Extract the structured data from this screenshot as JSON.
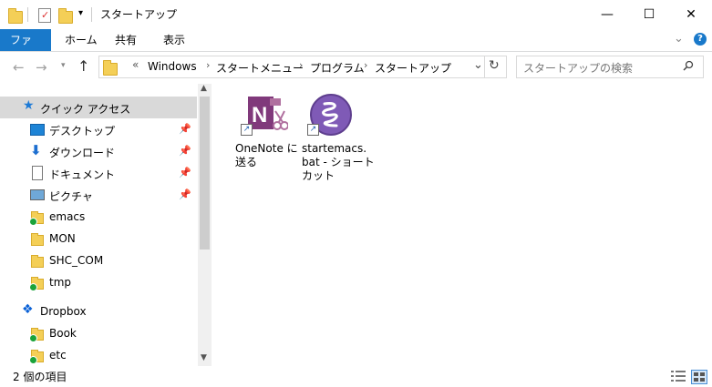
{
  "window": {
    "title": "スタートアップ",
    "controls": {
      "minimize": "—",
      "maximize": "☐",
      "close": "✕"
    }
  },
  "ribbon": {
    "tabs": [
      {
        "label": "ファイル",
        "active": true
      },
      {
        "label": "ホーム"
      },
      {
        "label": "共有"
      },
      {
        "label": "表示"
      }
    ],
    "expand": "⌄",
    "help": "?"
  },
  "address": {
    "overflow": "«",
    "crumbs": [
      "Windows",
      "スタートメニュー",
      "プログラム",
      "スタートアップ"
    ],
    "dropdown": "⌄",
    "refresh": "↻"
  },
  "search": {
    "placeholder": "スタートアップの検索",
    "icon": "search-icon"
  },
  "sidebar": {
    "quick_access": "クイック アクセス",
    "items": [
      {
        "label": "デスクトップ",
        "icon": "desktop-icon",
        "pinned": true
      },
      {
        "label": "ダウンロード",
        "icon": "download-icon",
        "pinned": true
      },
      {
        "label": "ドキュメント",
        "icon": "document-icon",
        "pinned": true
      },
      {
        "label": "ピクチャ",
        "icon": "picture-icon",
        "pinned": true
      },
      {
        "label": "emacs",
        "icon": "folder-icon",
        "synced": true
      },
      {
        "label": "MON",
        "icon": "folder-icon"
      },
      {
        "label": "SHC_COM",
        "icon": "folder-icon"
      },
      {
        "label": "tmp",
        "icon": "folder-icon",
        "synced": true
      }
    ],
    "dropbox": "Dropbox",
    "dropbox_items": [
      {
        "label": "Book",
        "icon": "folder-icon",
        "synced": true
      },
      {
        "label": "etc",
        "icon": "folder-icon",
        "synced": true
      }
    ]
  },
  "files": [
    {
      "label": "OneNote に\n送る",
      "icon": "onenote-icon",
      "color": "#80397b"
    },
    {
      "label": "startemacs.\nbat - ショート\nカット",
      "icon": "emacs-icon",
      "color": "#7f5ab6"
    }
  ],
  "status": {
    "count_text": "2 個の項目"
  },
  "colors": {
    "accent": "#1979ca",
    "selected": "#d9d9d9"
  }
}
